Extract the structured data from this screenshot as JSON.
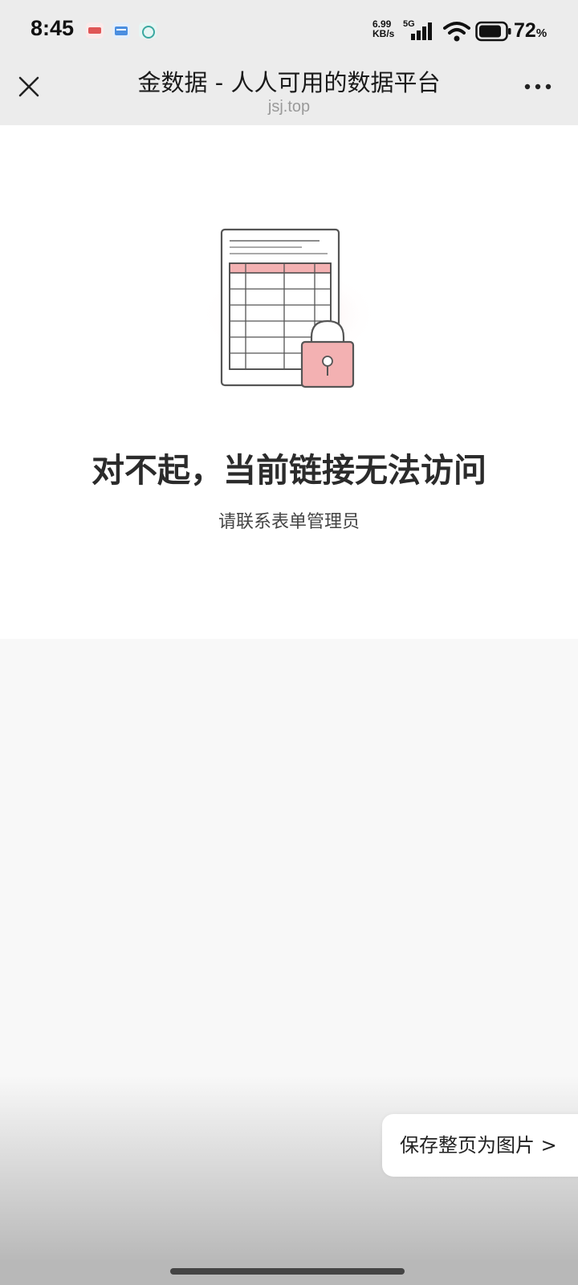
{
  "status_bar": {
    "time": "8:45",
    "network_speed_value": "6.99",
    "network_speed_unit": "KB/s",
    "network_type": "5G",
    "battery_level": "72",
    "battery_unit": "%",
    "notification_icons": [
      "ticket-app-icon",
      "mail-app-icon",
      "chat-app-icon"
    ]
  },
  "titlebar": {
    "title": "金数据 - 人人可用的数据平台",
    "domain": "jsj.top"
  },
  "content": {
    "headline": "对不起，当前链接无法访问",
    "subtitle": "请联系表单管理员"
  },
  "floating_action": {
    "label": "保存整页为图片 >"
  },
  "colors": {
    "accent_pink": "#f3b1b2",
    "background": "#f8f8f8",
    "card": "#ffffff"
  }
}
